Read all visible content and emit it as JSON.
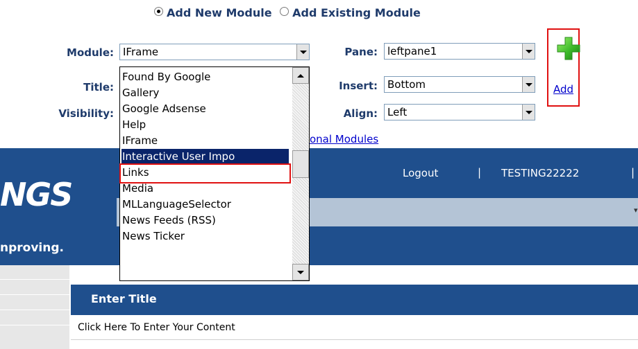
{
  "mode": {
    "option_new": "Add New Module",
    "option_existing": "Add Existing Module",
    "selected": "Add New Module"
  },
  "form": {
    "module_label": "Module:",
    "module_value": "IFrame",
    "title_label": "Title:",
    "visibility_label": "Visibility:",
    "pane_label": "Pane:",
    "pane_value": "leftpane1",
    "insert_label": "Insert:",
    "insert_value": "Bottom",
    "align_label": "Align:",
    "align_value": "Left",
    "add_label": "Add",
    "additional_modules_link": "onal Modules"
  },
  "dropdown": {
    "options": [
      "Found By Google",
      "Gallery",
      "Google Adsense",
      "Help",
      "IFrame",
      "Interactive User Impo",
      "Links",
      "Media",
      "MLLanguageSelector",
      "News Feeds (RSS)",
      "News Ticker"
    ],
    "highlighted": "Interactive User Impo"
  },
  "site": {
    "logo_text": "NGS",
    "tagline": "nproving.",
    "logout": "Logout",
    "separator": "|",
    "username": "TESTING22222"
  },
  "module": {
    "title": "Enter Title",
    "content": "Click Here To Enter Your Content"
  },
  "colors": {
    "banner_blue": "#1f4f8d",
    "highlight_red": "#e01010",
    "selection_navy": "#0a246a",
    "plus_green": "#3dbb2a"
  },
  "icons": {
    "add": "green-plus-icon",
    "radio_selected": "radio-checked",
    "radio_unselected": "radio-unchecked"
  }
}
